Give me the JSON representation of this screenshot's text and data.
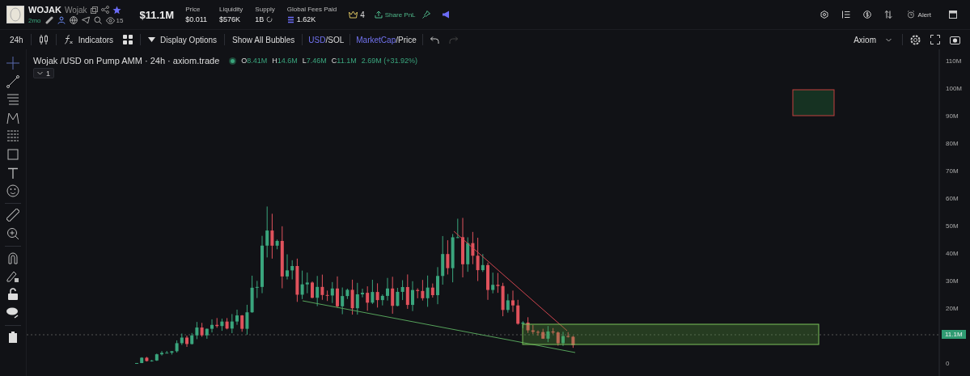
{
  "token": {
    "ticker": "WOJAK",
    "name": "Wojak",
    "age": "2mo",
    "watchers": "15"
  },
  "market_cap": "$11.1M",
  "stats": [
    {
      "label": "Price",
      "value": "$0.011"
    },
    {
      "label": "Liquidity",
      "value": "$576K"
    },
    {
      "label": "Supply",
      "value": "1B"
    },
    {
      "label": "Global Fees Paid",
      "value": "1.62K"
    }
  ],
  "crown_count": "4",
  "share_button": "Share PnL",
  "alert_button": "Alert",
  "toolbar": {
    "interval": "24h",
    "indicators": "Indicators",
    "display_options": "Display Options",
    "bubbles": "Show All Bubbles",
    "currency": {
      "separator": "/",
      "options": [
        {
          "label": "USD",
          "selected": true
        },
        {
          "label": "SOL",
          "selected": false
        }
      ]
    },
    "metric": {
      "separator": "/",
      "options": [
        {
          "label": "MarketCap",
          "selected": true
        },
        {
          "label": "Price",
          "selected": false
        }
      ]
    },
    "layout": "Axiom"
  },
  "legend": {
    "title": "Wojak /USD on Pump AMM · 24h · axiom.trade",
    "ohlc": [
      {
        "key": "O",
        "value": "8.41M"
      },
      {
        "key": "H",
        "value": "14.6M"
      },
      {
        "key": "L",
        "value": "7.46M"
      },
      {
        "key": "C",
        "value": "11.1M"
      }
    ],
    "change": "2.69M (+31.92%)",
    "collapse": "1"
  },
  "price_axis": [
    "110M",
    "100M",
    "90M",
    "80M",
    "70M",
    "60M",
    "50M",
    "40M",
    "30M",
    "20M",
    "0"
  ],
  "price_label": "11.1M"
}
